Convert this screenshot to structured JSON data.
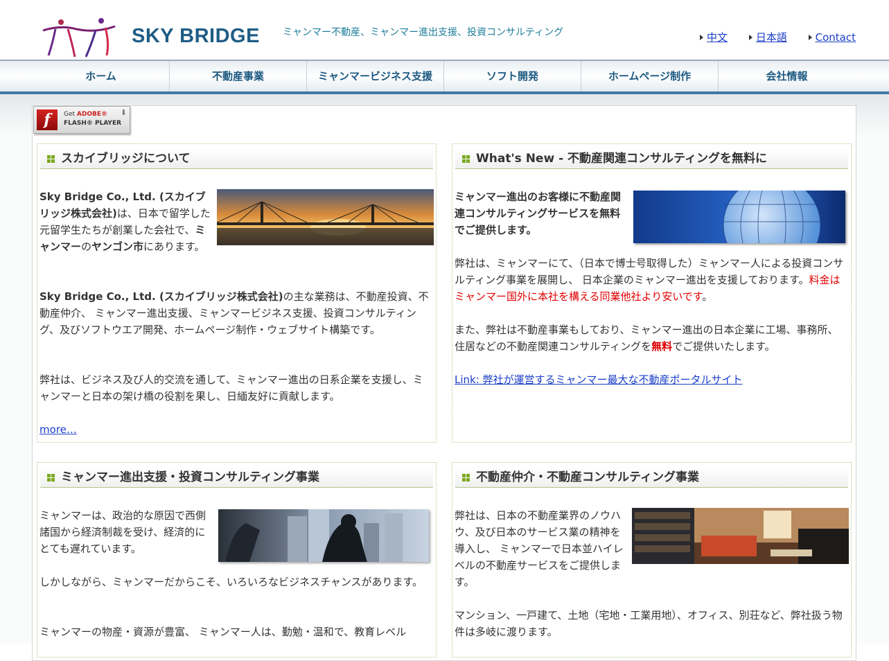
{
  "header": {
    "logo_text": "SKY BRIDGE",
    "tagline": "ミャンマー不動産、ミャンマー進出支援、投資コンサルティング",
    "links": [
      "中文",
      "日本語",
      "Contact"
    ]
  },
  "nav": [
    "ホーム",
    "不動産事業",
    "ミャンマービジネス支援",
    "ソフト開発",
    "ホームページ制作",
    "会社情報"
  ],
  "flash": {
    "get": "Get",
    "adobe": "ADOBE®",
    "player": "FLASH® PLAYER"
  },
  "about": {
    "title": "スカイブリッジについて",
    "p1": {
      "a": "Sky Bridge Co., Ltd. (スカイブリッジ株式会社)",
      "b": "は、日本で留学した元留学生たちが創業した会社で、",
      "c": "ミャンマー",
      "d": "の",
      "e": "ヤンゴン市",
      "f": "にあります。"
    },
    "p2": {
      "a": "Sky Bridge Co., Ltd. (スカイブリッジ株式会社)",
      "b": "の主な業務は、不動産投資、不動産仲介、 ミャンマー進出支援、ミャンマービジネス支援、投資コンサルティング、及びソフトウエア開発、ホームページ制作・ウェブサイト構築です。"
    },
    "p3": "弊社は、ビジネス及び人的交流を通して、ミャンマー進出の日系企業を支援し、ミャンマーと日本の架け橋の役割を果し、日緬友好に貢献します。",
    "more": "more…"
  },
  "news": {
    "title": "What's New - 不動産関連コンサルティングを無料に",
    "lead": "ミャンマー進出のお客様に不動産関連コンサルティングサービスを無料でご提供します。",
    "p1a": "弊社は、ミャンマーにて、（日本で博士号取得した）ミャンマー人による投資コンサルティング事業を展開し、 日本企業のミャンマー進出を支援しております。",
    "p1red": "料金はミャンマー国外に本社を構える同業他社より安いです",
    "p1end": "。",
    "p2a": "また、弊社は不動産事業もしており、ミャンマー進出の日本企業に工場、事務所、住居などの不動産関連コンサルティングを",
    "p2red": "無料",
    "p2b": "でご提供いたします。",
    "link": "Link: 弊社が運営するミャンマー最大な不動産ポータルサイト"
  },
  "support": {
    "title": "ミャンマー進出支援・投資コンサルティング事業",
    "p1": "ミャンマーは、政治的な原因で西側諸国から経済制裁を受け、経済的にとても遅れています。",
    "p2": "しかしながら、ミャンマーだからこそ、いろいろなビジネスチャンスがあります。",
    "p3": "ミャンマーの物産・資源が豊富、 ミャンマー人は、勤勉・温和で、教育レベル"
  },
  "realestate": {
    "title": "不動産仲介・不動産コンサルティング事業",
    "p1": "弊社は、日本の不動産業界のノウハウ、及び日本のサービス業の精神を導入し、 ミャンマーで日本並ハイレベルの不動産サービスをご提供します。",
    "p2": "マンション、一戸建て、土地（宅地・工業用地）、オフィス、別荘など、弊社扱う物件は多岐に渡ります。"
  }
}
